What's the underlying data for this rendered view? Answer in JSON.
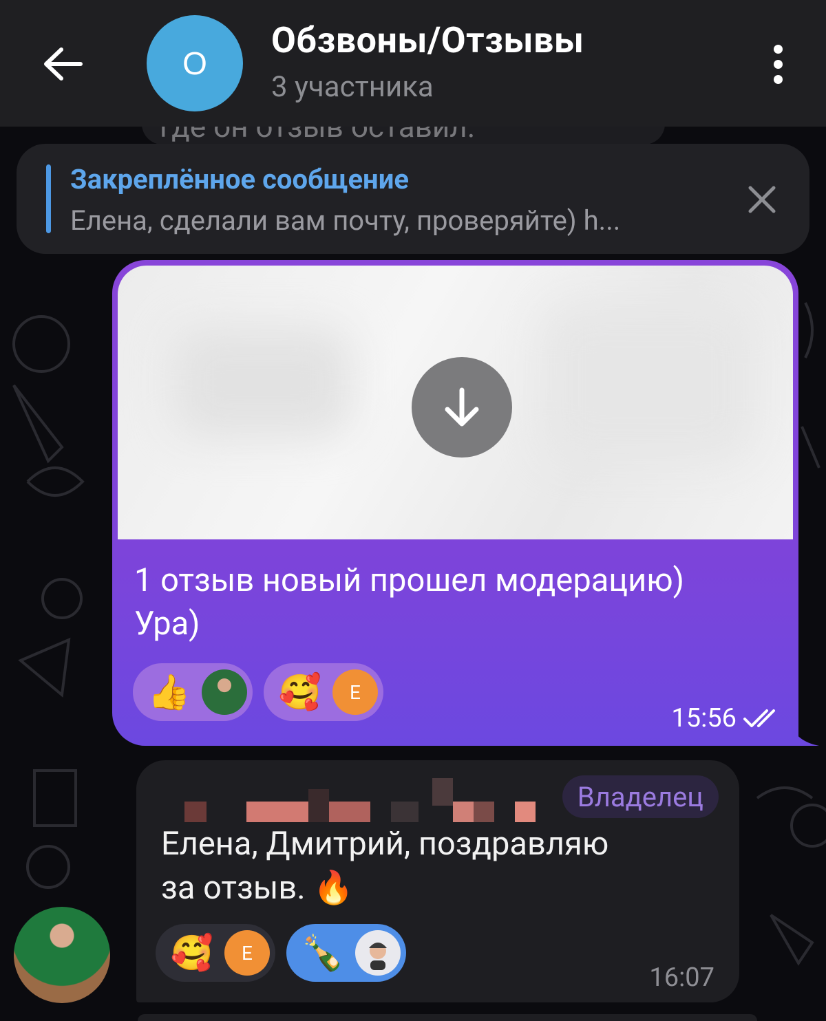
{
  "header": {
    "chat_title": "Обзвоны/Отзывы",
    "chat_subtitle": "3 участника",
    "avatar_letter": "О",
    "avatar_color": "#48a9dd"
  },
  "previous_message": {
    "text_fragment": "где он отзыв оставил."
  },
  "pinned": {
    "title": "Закреплённое сообщение",
    "text": "Елена, сделали вам почту, проверяйте) h..."
  },
  "outgoing_message": {
    "text_line1": "1 отзыв новый прошел модерацию)",
    "text_line2": "Ура)",
    "time": "15:56",
    "status": "read",
    "reactions": [
      {
        "emoji": "👍",
        "user_avatar": "photo"
      },
      {
        "emoji": "🥰",
        "user_avatar": "initial",
        "initial": "Е"
      }
    ]
  },
  "incoming_message": {
    "badge": "Владелец",
    "text_line1": "Елена, Дмитрий, поздравляю",
    "text_line2": "за отзыв. 🔥",
    "time": "16:07",
    "reactions": [
      {
        "emoji": "🥰",
        "user_avatar": "initial",
        "initial": "Е"
      },
      {
        "emoji": "🍾",
        "user_avatar": "memoji"
      }
    ]
  },
  "colors": {
    "accent_blue": "#5ea6ec",
    "outgoing_bubble": "#8845d9",
    "incoming_bubble": "#1e1e22",
    "owner_badge_text": "#9b7be0"
  }
}
